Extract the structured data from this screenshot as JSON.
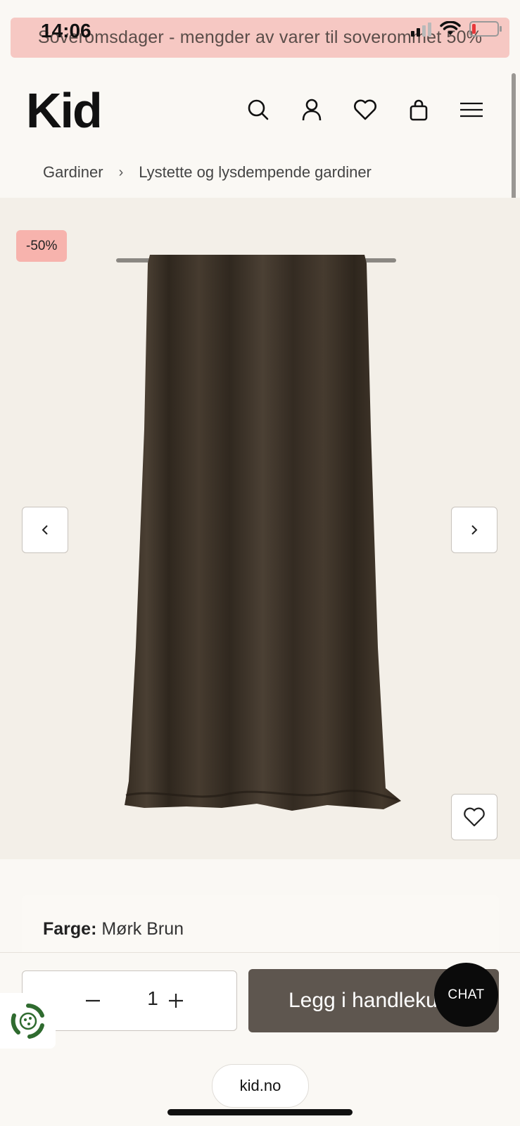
{
  "status_bar": {
    "time": "14:06"
  },
  "promo_banner": {
    "text": "Soveromsdager - mengder av varer til soverommet 50%"
  },
  "header": {
    "logo": "Kid",
    "icons": [
      "search-icon",
      "account-icon",
      "wishlist-heart-icon",
      "shopping-bag-icon",
      "menu-icon"
    ]
  },
  "breadcrumb": {
    "items": [
      "Gardiner",
      "Lystette og lysdempende gardiner"
    ],
    "separator": "›"
  },
  "product": {
    "discount_badge": "-50%",
    "image_alt": "Mørk brun velour gardin",
    "color_label": "Farge:",
    "color_value": "Mørk Brun"
  },
  "purchase": {
    "quantity": "1",
    "add_to_cart_label": "Legg i handlekurv"
  },
  "chat": {
    "label": "CHAT"
  },
  "browser": {
    "url": "kid.no"
  },
  "colors": {
    "promo_bg": "#f6c8c3",
    "discount_bg": "#f7b3ad",
    "add_to_cart_bg": "#5e564f",
    "curtain": "#3e3429",
    "page_bg": "#faf8f4"
  }
}
